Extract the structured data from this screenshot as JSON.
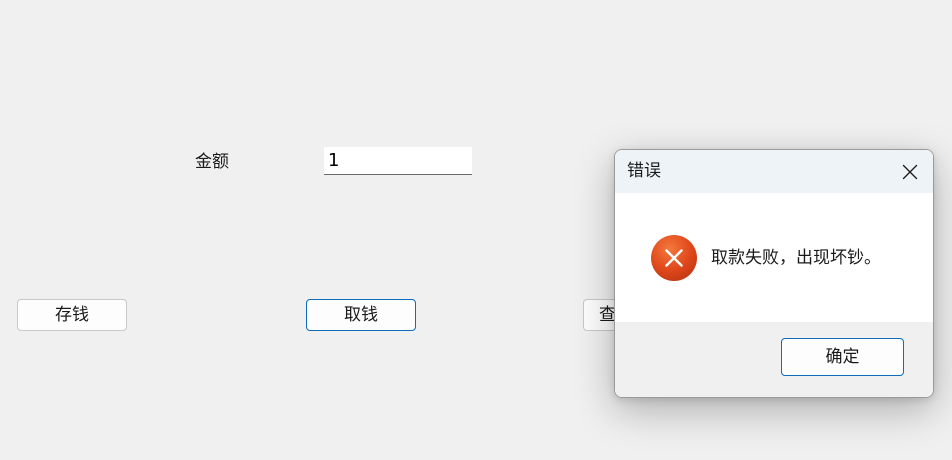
{
  "form": {
    "amount_label": "金额",
    "amount_value": "1"
  },
  "buttons": {
    "deposit_label": "存钱",
    "withdraw_label": "取钱",
    "query_label": "查"
  },
  "dialog": {
    "title": "错误",
    "message": "取款失败，出现坏钞。",
    "ok_label": "确定",
    "icon": "error-icon",
    "close_icon": "close-icon"
  },
  "colors": {
    "background": "#f0f0f0",
    "accent_border": "#0f6cbd",
    "error_icon": "#e0491c",
    "titlebar": "#eef3f8"
  }
}
